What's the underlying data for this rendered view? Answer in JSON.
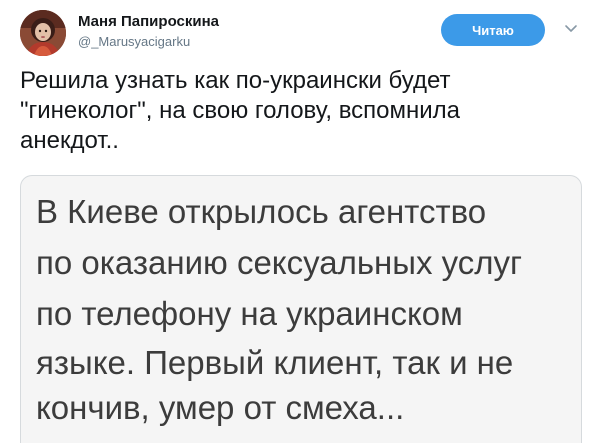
{
  "author": {
    "display_name": "Маня Папироскина",
    "handle": "@_Marusyacigarku"
  },
  "follow_button": {
    "label": "Читаю"
  },
  "more_menu": {
    "icon": "chevron-down-icon"
  },
  "tweet": {
    "text": "Решила узнать как по-украински будет\n\"гинеколог\", на свою голову, вспомнила\nанекдот.."
  },
  "media": {
    "lines": [
      "В Киеве открылось  агентство",
      "по оказанию сексуальных услуг",
      "по телефону на украинском",
      "языке. Первый клиент, так и не",
      "кончив, умер от смеха..."
    ]
  },
  "colors": {
    "accent": "#3c9ae8",
    "name": "#14171a",
    "secondary": "#657786",
    "media_bg": "#f5f5f5",
    "media_text": "#3c3c3c"
  }
}
